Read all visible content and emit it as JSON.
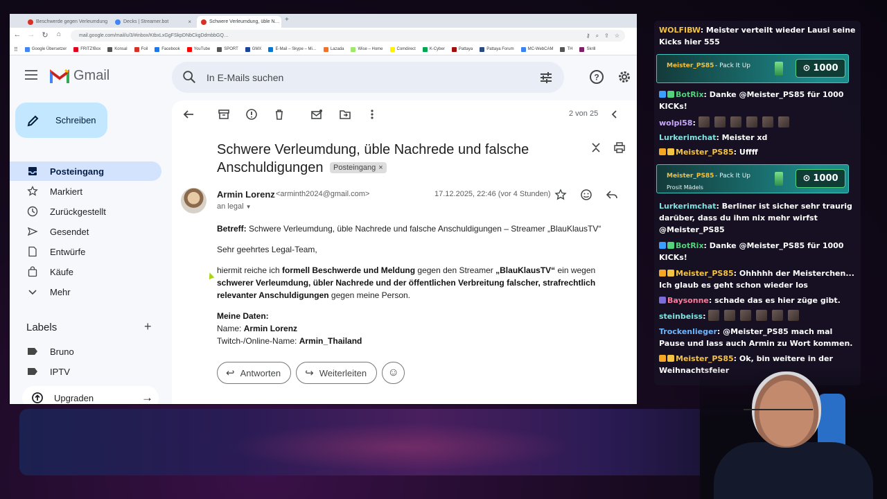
{
  "browser": {
    "tabs": [
      {
        "title": "Beschwerde gegen Verleumdung",
        "color": "#d93025"
      },
      {
        "title": "Decks | Streamer.bot",
        "color": "#4285f4"
      },
      {
        "title": "Schwere Verleumdung, üble N…",
        "color": "#d93025"
      }
    ],
    "url": "mail.google.com/mail/u/3/#inbox/KtbxLxGgFSkpDNbCkgDdmbbGQ…",
    "bookmarks": [
      {
        "label": "Google Übersetzer",
        "color": "#4285f4"
      },
      {
        "label": "FRITZ!Box",
        "color": "#e2001a"
      },
      {
        "label": "Konsal",
        "color": "#555555"
      },
      {
        "label": "Foil",
        "color": "#d93025"
      },
      {
        "label": "Facebook",
        "color": "#1877f2"
      },
      {
        "label": "YouTube",
        "color": "#ff0000"
      },
      {
        "label": "SPORT",
        "color": "#555555"
      },
      {
        "label": "GMX",
        "color": "#1c449b"
      },
      {
        "label": "E-Mail – Skype – Mi…",
        "color": "#0078d4"
      },
      {
        "label": "Lazada",
        "color": "#f57224"
      },
      {
        "label": "Wise – Home",
        "color": "#9fe870"
      },
      {
        "label": "Comdirect",
        "color": "#fff200"
      },
      {
        "label": "K-Cyber",
        "color": "#00a650"
      },
      {
        "label": "Pattaya",
        "color": "#a10e0e"
      },
      {
        "label": "Pattaya Forum",
        "color": "#2b4b7e"
      },
      {
        "label": "MC-WebCAM",
        "color": "#3b82f6"
      },
      {
        "label": "TH",
        "color": "#555555"
      },
      {
        "label": "Skrill",
        "color": "#811e68"
      }
    ]
  },
  "gmail": {
    "brand": "Gmail",
    "search_placeholder": "In E-Mails suchen",
    "compose_label": "Schreiben",
    "sidebar": [
      {
        "label": "Posteingang",
        "icon": "inbox-icon"
      },
      {
        "label": "Markiert",
        "icon": "star-icon"
      },
      {
        "label": "Zurückgestellt",
        "icon": "clock-icon"
      },
      {
        "label": "Gesendet",
        "icon": "send-icon"
      },
      {
        "label": "Entwürfe",
        "icon": "draft-icon"
      },
      {
        "label": "Käufe",
        "icon": "shopping-bag-icon"
      },
      {
        "label": "Mehr",
        "icon": "chevron-down-icon"
      }
    ],
    "labels_title": "Labels",
    "labels": [
      "Bruno",
      "IPTV"
    ],
    "upgrade_label": "Upgraden",
    "pager": "2 von 25",
    "subject": "Schwere Verleumdung, üble Nachrede und falsche Anschuldigungen",
    "inbox_chip": "Posteingang",
    "sender_name": "Armin Lorenz",
    "sender_email": "<arminth2024@gmail.com>",
    "recipient": "an legal",
    "date": "17.12.2025, 22:46 (vor 4 Stunden)",
    "body": {
      "betreff_label": "Betreff:",
      "betreff_text": "Schwere Verleumdung, üble Nachrede und falsche Anschuldigungen – Streamer „BlauKlausTV“",
      "greeting": "Sehr geehrtes Legal-Team,",
      "p1_a": "hiermit reiche ich ",
      "p1_b": "formell Beschwerde und Meldung",
      "p1_c": " gegen den Streamer ",
      "p1_d": "„BlauKlausTV“",
      "p1_e": " ein wegen ",
      "p1_f": "schwerer Verleumdung, übler Nachrede und der öffentlichen Verbreitung falscher, strafrechtlich relevanter Anschuldigungen",
      "p1_g": " gegen meine Person.",
      "data_heading": "Meine Daten:",
      "name_label": "Name: ",
      "name_value": "Armin Lorenz",
      "twitch_label": "Twitch-/Online-Name: ",
      "twitch_value": "Armin_Thailand"
    },
    "reply_label": "Antworten",
    "forward_label": "Weiterleiten"
  },
  "chat": {
    "messages": [
      {
        "user": "WOLFIBW",
        "color": "#f5c342",
        "text": ": Meister verteilt wieder Lausi seine Kicks hier 555"
      },
      {
        "user": "BotRix",
        "color": "#52d27a",
        "text": ": Danke @Meister_PS85 für 1000 KICKs!"
      },
      {
        "user": "wolpi58",
        "color": "#c9a7ff",
        "text": ":"
      },
      {
        "user": "Lurkerimchat",
        "color": "#7fe3e0",
        "text": ": Meister xd"
      },
      {
        "user": "Meister_PS85",
        "color": "#f5c342",
        "text": ": Uffff"
      },
      {
        "user": "Lurkerimchat",
        "color": "#7fe3e0",
        "text": ": Berliner ist sicher sehr traurig darüber, dass du ihm nix mehr wirfst @Meister_PS85"
      },
      {
        "user": "BotRix",
        "color": "#52d27a",
        "text": ": Danke @Meister_PS85 für 1000 KICKs!"
      },
      {
        "user": "Meister_PS85",
        "color": "#f5c342",
        "text": ": Ohhhhh der Meisterchen... Ich glaub es geht schon wieder los"
      },
      {
        "user": "Baysonne",
        "color": "#ff7a9a",
        "text": ": schade das es hier züge gibt."
      },
      {
        "user": "steinbeiss",
        "color": "#7fe3e0",
        "text": ":"
      },
      {
        "user": "Trockenlieger",
        "color": "#6cb7ff",
        "text": ": @Meister_PS85 mach mal Pause und lass auch Armin zu Wort kommen."
      },
      {
        "user": "Meister_PS85",
        "color": "#f5c342",
        "text": ": Ok, bin weitere in der Weihnachtsfeier"
      }
    ],
    "gifts": [
      {
        "user": "Meister_PS85",
        "text": "- Pack It Up",
        "sub": "",
        "amount": "1000"
      },
      {
        "user": "Meister_PS85",
        "text": "- Pack It Up",
        "sub": "Prosit Mädels",
        "amount": "1000"
      }
    ]
  }
}
